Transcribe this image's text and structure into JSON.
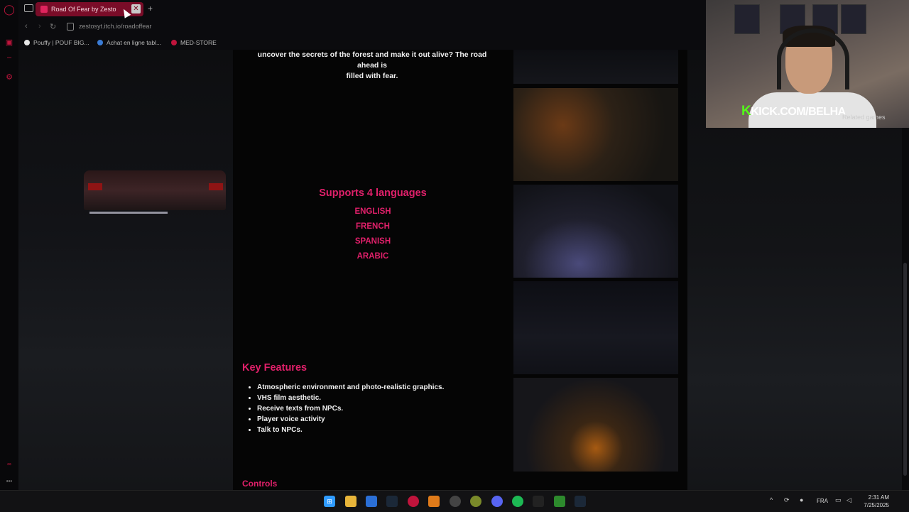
{
  "browser": {
    "tab_title": "Road Of Fear by Zesto",
    "new_tab_symbol": "+",
    "close_symbol": "✕",
    "url": "zestosyt.itch.io/roadoffear",
    "bookmarks": [
      {
        "label": "Pouffy | POUF BIG...",
        "color": "#e6e6e6"
      },
      {
        "label": "Achat en ligne tabl...",
        "color": "#3a7bd5"
      },
      {
        "label": "MED-STORE",
        "color": "#c0143c"
      }
    ]
  },
  "page": {
    "intro_line1": "uncover the secrets of the forest and make it out alive? The road ahead is",
    "intro_line2": "filled with fear.",
    "languages_title": "Supports 4 languages",
    "languages": [
      "ENGLISH",
      "FRENCH",
      "SPANISH",
      "ARABIC"
    ],
    "key_features_title": "Key Features",
    "key_features": [
      "Atmospheric environment and photo-realistic graphics.",
      "VHS film aesthetic.",
      "Receive texts from NPCs.",
      "Player voice activity",
      "Talk to NPCs."
    ],
    "controls_title": "Controls",
    "accent_color": "#e0206a"
  },
  "overlay": {
    "kick_k": "K",
    "kick_text": "KICK.COM/BELHA",
    "related_games": "Related games"
  },
  "taskbar": {
    "language": "FRA",
    "time": "2:31 AM",
    "date": "7/25/2025"
  }
}
